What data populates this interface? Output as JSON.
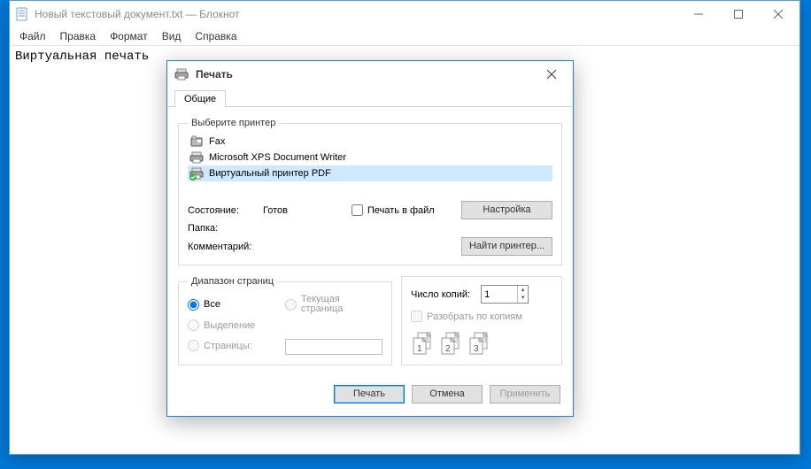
{
  "notepad": {
    "title": "Новый текстовый документ.txt — Блокнот",
    "menus": {
      "file": "Файл",
      "edit": "Правка",
      "format": "Формат",
      "view": "Вид",
      "help": "Справка"
    },
    "content": "Виртуальная печать"
  },
  "print_dialog": {
    "title": "Печать",
    "tab_general": "Общие",
    "select_printer": "Выберите принтер",
    "printers": {
      "fax": "Fax",
      "xps": "Microsoft XPS Document Writer",
      "virtual_pdf": "Виртуальный принтер PDF"
    },
    "status_label": "Состояние:",
    "status_value": "Готов",
    "location_label": "Папка:",
    "comment_label": "Комментарий:",
    "print_to_file": "Печать в файл",
    "prefs_btn": "Настройка",
    "find_printer_btn": "Найти принтер...",
    "page_range_legend": "Диапазон страниц",
    "range_all": "Все",
    "range_selection": "Выделение",
    "range_pages": "Страницы:",
    "range_current": "Текущая страница",
    "copies_label": "Число копий:",
    "copies_value": "1",
    "collate": "Разобрать по копиям",
    "collate_pages": {
      "a": "1",
      "b": "2",
      "c": "3"
    },
    "btn_print": "Печать",
    "btn_cancel": "Отмена",
    "btn_apply": "Применить"
  }
}
